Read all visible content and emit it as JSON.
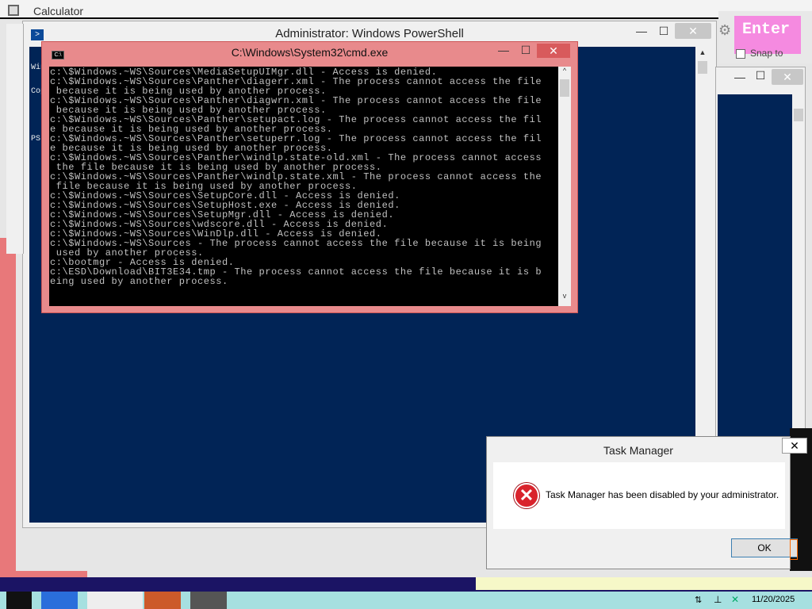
{
  "background": {
    "calculator_title": "Calculator"
  },
  "powershell": {
    "title": "Administrator: Windows PowerShell",
    "lines": [
      "Win",
      "Cop",
      "",
      "PS"
    ],
    "controls": {
      "minimize": "—",
      "maximize": "☐",
      "close": "✕"
    }
  },
  "cmd": {
    "title": "C:\\Windows\\System32\\cmd.exe",
    "icon_label": "C:\\",
    "controls": {
      "minimize": "—",
      "maximize": "☐",
      "close": "✕"
    },
    "output": "c:\\$Windows.~WS\\Sources\\MediaSetupUIMgr.dll - Access is denied.\nc:\\$Windows.~WS\\Sources\\Panther\\diagerr.xml - The process cannot access the file\n because it is being used by another process.\nc:\\$Windows.~WS\\Sources\\Panther\\diagwrn.xml - The process cannot access the file\n because it is being used by another process.\nc:\\$Windows.~WS\\Sources\\Panther\\setupact.log - The process cannot access the fil\ne because it is being used by another process.\nc:\\$Windows.~WS\\Sources\\Panther\\setuperr.log - The process cannot access the fil\ne because it is being used by another process.\nc:\\$Windows.~WS\\Sources\\Panther\\windlp.state-old.xml - The process cannot access\n the file because it is being used by another process.\nc:\\$Windows.~WS\\Sources\\Panther\\windlp.state.xml - The process cannot access the\n file because it is being used by another process.\nc:\\$Windows.~WS\\Sources\\SetupCore.dll - Access is denied.\nc:\\$Windows.~WS\\Sources\\SetupHost.exe - Access is denied.\nc:\\$Windows.~WS\\Sources\\SetupMgr.dll - Access is denied.\nc:\\$Windows.~WS\\Sources\\wdscore.dll - Access is denied.\nc:\\$Windows.~WS\\Sources\\WinDlp.dll - Access is denied.\nc:\\$Windows.~WS\\Sources - The process cannot access the file because it is being\n used by another process.\nc:\\bootmgr - Access is denied.\nc:\\ESD\\Download\\BIT3E34.tmp - The process cannot access the file because it is b\neing used by another process."
  },
  "osk": {
    "enter_key": "Enter",
    "snap_label": "Snap to"
  },
  "task_manager_dialog": {
    "title": "Task Manager",
    "message": "Task Manager has been disabled by your administrator.",
    "ok_label": "OK",
    "close": "✕"
  },
  "taskbar": {
    "clock": "11/20/2025"
  },
  "colors": {
    "powershell_bg": "#012456",
    "cmd_frame": "#e88a8c",
    "error_red": "#d9232c",
    "osk_key": "#f58ae0"
  }
}
